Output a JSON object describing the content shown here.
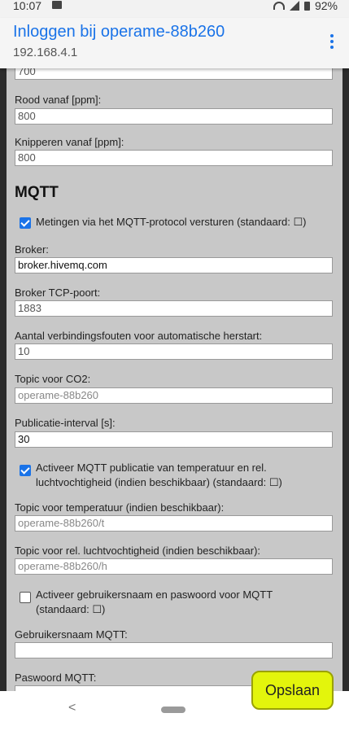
{
  "status": {
    "time": "10:07",
    "battery": "92%"
  },
  "appbar": {
    "title": "Inloggen bij operame-88b260",
    "subtitle": "192.168.4.1"
  },
  "form": {
    "prev_value": "700",
    "red_label": "Rood vanaf [ppm]:",
    "red_value": "800",
    "blink_label": "Knipperen vanaf [ppm]:",
    "blink_value": "800",
    "mqtt_title": "MQTT",
    "mqtt_send_label": "Metingen via het MQTT-protocol versturen (standaard: ☐)",
    "broker_label": "Broker:",
    "broker_value": "broker.hivemq.com",
    "port_label": "Broker TCP-poort:",
    "port_value": "1883",
    "errors_label": "Aantal verbindingsfouten voor automatische herstart:",
    "errors_value": "10",
    "topic_co2_label": "Topic voor CO2:",
    "topic_co2_placeholder": "operame-88b260",
    "interval_label": "Publicatie-interval [s]:",
    "interval_value": "30",
    "temp_pub_line1": "Activeer MQTT publicatie van temperatuur en rel.",
    "temp_pub_line2": "luchtvochtigheid (indien beschikbaar) (standaard: ☐)",
    "topic_temp_label": "Topic voor temperatuur (indien beschikbaar):",
    "topic_temp_placeholder": "operame-88b260/t",
    "topic_hum_label": "Topic voor rel. luchtvochtigheid (indien beschikbaar):",
    "topic_hum_placeholder": "operame-88b260/h",
    "auth_line1": "Activeer gebruikersnaam en paswoord voor MQTT",
    "auth_line2": "(standaard: ☐)",
    "username_label": "Gebruikersnaam MQTT:",
    "username_value": "",
    "password_label": "Paswoord MQTT:",
    "password_value": ""
  },
  "save_button": "Opslaan",
  "nav": {
    "back": "<"
  },
  "colors": {
    "accent": "#1a73e8",
    "save": "#e3f50c",
    "panel": "#c8c8c8"
  }
}
